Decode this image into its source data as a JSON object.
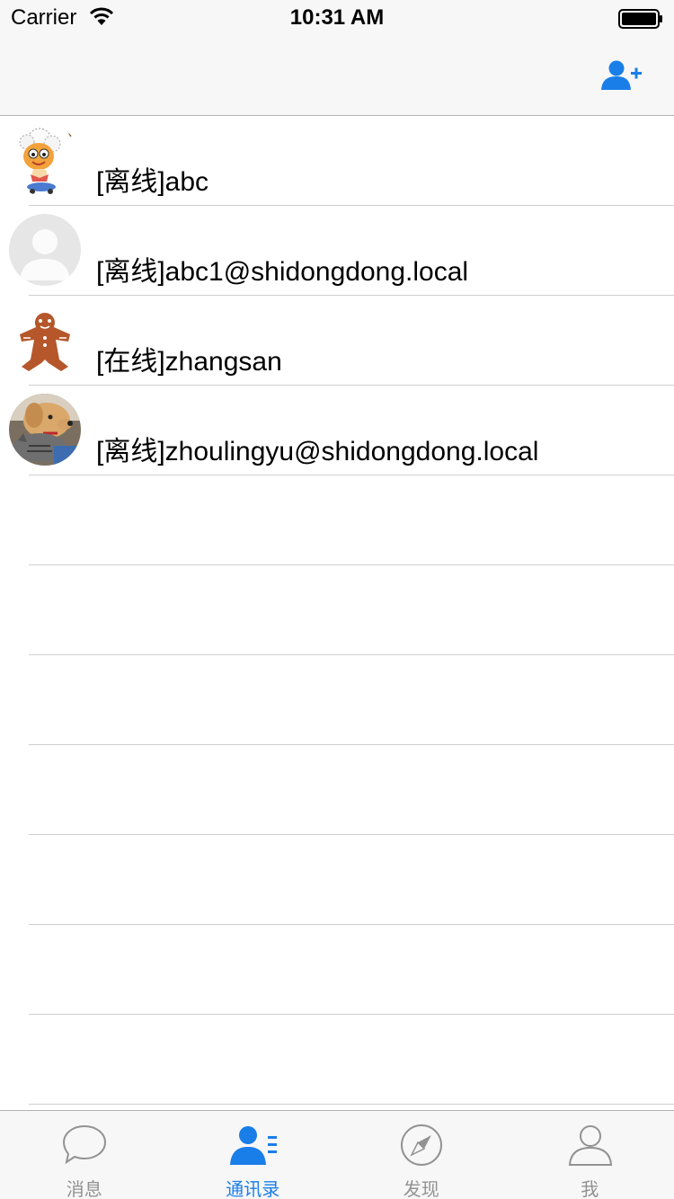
{
  "status_bar": {
    "carrier": "Carrier",
    "time": "10:31 AM"
  },
  "nav_bar": {
    "add_contact_icon": "add-contact-icon"
  },
  "contacts": [
    {
      "status": "[离线]",
      "name": "abc",
      "display": "[离线]abc",
      "avatar": "cartoon-sheep-avatar"
    },
    {
      "status": "[离线]",
      "name": "abc1@shidongdong.local",
      "display": "[离线]abc1@shidongdong.local",
      "avatar": "default-avatar"
    },
    {
      "status": "[在线]",
      "name": "zhangsan",
      "display": "[在线]zhangsan",
      "avatar": "gingerbread-avatar"
    },
    {
      "status": "[离线]",
      "name": "zhoulingyu@shidongdong.local",
      "display": "[离线]zhoulingyu@shidongdong.local",
      "avatar": "dog-cat-photo-avatar"
    }
  ],
  "tab_bar": {
    "tabs": [
      {
        "label": "消息",
        "icon": "chat-bubble-icon",
        "active": false
      },
      {
        "label": "通讯录",
        "icon": "contacts-icon",
        "active": true
      },
      {
        "label": "发现",
        "icon": "compass-icon",
        "active": false
      },
      {
        "label": "我",
        "icon": "person-icon",
        "active": false
      }
    ]
  },
  "colors": {
    "accent": "#1a7ee8",
    "inactive": "#929292",
    "bar_background": "#f7f7f7",
    "separator": "#cfcfcf"
  }
}
